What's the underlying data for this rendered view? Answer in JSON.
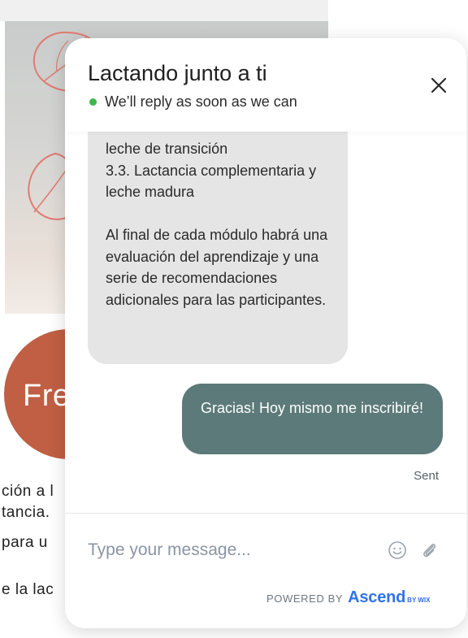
{
  "background": {
    "circle_text": "Fre",
    "lines": [
      "ción a l",
      "tancia.",
      "para u",
      "e la lac"
    ]
  },
  "chat": {
    "title": "Lactando junto a ti",
    "status_text": "We’ll reply as soon as we can",
    "status_color": "#3fb74b",
    "incoming_message": "leche de transición\n3.3. Lactancia complementaria y leche madura\n\nAl final de cada módulo habrá una evaluación del aprendizaje y una serie de recomendaciones adicionales para las participantes.",
    "outgoing_message": "Gracias! Hoy mismo me inscribiré!",
    "outgoing_status": "Sent",
    "input_placeholder": "Type your message...",
    "powered_by": "POWERED BY",
    "brand": "Ascend",
    "brand_suffix": "BY WIX",
    "accent_color": "#5c7a79",
    "brand_color": "#2f73e8"
  }
}
